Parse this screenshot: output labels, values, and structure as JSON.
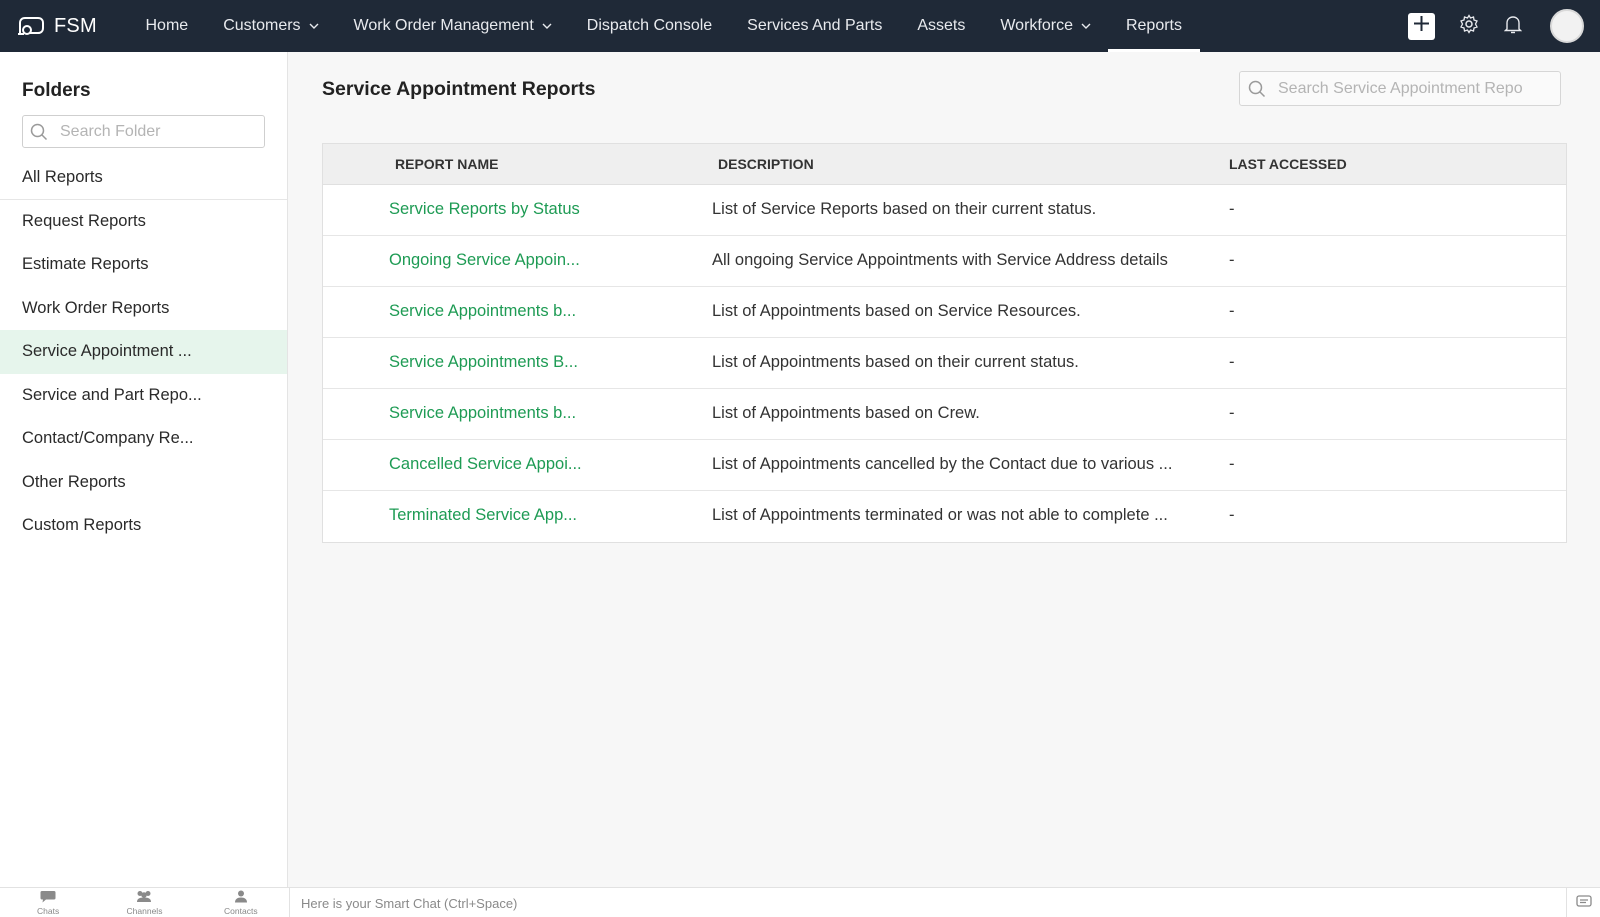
{
  "app": {
    "name": "FSM"
  },
  "nav": {
    "items": [
      {
        "label": "Home",
        "dropdown": false
      },
      {
        "label": "Customers",
        "dropdown": true
      },
      {
        "label": "Work Order Management",
        "dropdown": true
      },
      {
        "label": "Dispatch Console",
        "dropdown": false
      },
      {
        "label": "Services And Parts",
        "dropdown": false
      },
      {
        "label": "Assets",
        "dropdown": false
      },
      {
        "label": "Workforce",
        "dropdown": true
      },
      {
        "label": "Reports",
        "dropdown": false,
        "active": true
      }
    ],
    "icons": [
      "plus-icon",
      "gear-icon",
      "bell-icon",
      "avatar"
    ]
  },
  "sidebar": {
    "title": "Folders",
    "search_placeholder": "Search Folder",
    "items": [
      {
        "label": "All Reports"
      },
      {
        "label": "Request Reports"
      },
      {
        "label": "Estimate Reports"
      },
      {
        "label": "Work Order Reports"
      },
      {
        "label": "Service Appointment ...",
        "active": true
      },
      {
        "label": "Service and Part Repo..."
      },
      {
        "label": "Contact/Company Re..."
      },
      {
        "label": "Other Reports"
      },
      {
        "label": "Custom Reports"
      }
    ]
  },
  "main": {
    "title": "Service Appointment Reports",
    "search_placeholder": "Search Service Appointment Repo",
    "columns": {
      "name": "REPORT NAME",
      "description": "DESCRIPTION",
      "last_accessed": "LAST ACCESSED"
    },
    "rows": [
      {
        "name": "Service Reports by Status",
        "description": "List of Service Reports based on their current status.",
        "last_accessed": "-"
      },
      {
        "name": "Ongoing Service Appoin...",
        "description": "All ongoing Service Appointments with Service Address details",
        "last_accessed": "-"
      },
      {
        "name": "Service Appointments b...",
        "description": "List of Appointments based on Service Resources.",
        "last_accessed": "-"
      },
      {
        "name": "Service Appointments B...",
        "description": "List of Appointments based on their current status.",
        "last_accessed": "-"
      },
      {
        "name": "Service Appointments b...",
        "description": "List of Appointments based on Crew.",
        "last_accessed": "-"
      },
      {
        "name": "Cancelled Service Appoi...",
        "description": "List of Appointments cancelled by the Contact due to various ...",
        "last_accessed": "-"
      },
      {
        "name": "Terminated Service App...",
        "description": "List of Appointments terminated or was not able to complete ...",
        "last_accessed": "-"
      }
    ]
  },
  "bottombar": {
    "items": [
      {
        "label": "Chats"
      },
      {
        "label": "Channels"
      },
      {
        "label": "Contacts"
      }
    ],
    "chat_hint": "Here is your Smart Chat (Ctrl+Space)"
  },
  "colors": {
    "nav_bg": "#1f2937",
    "link_green": "#1e9b54",
    "active_folder_bg": "#e6f5ec"
  }
}
